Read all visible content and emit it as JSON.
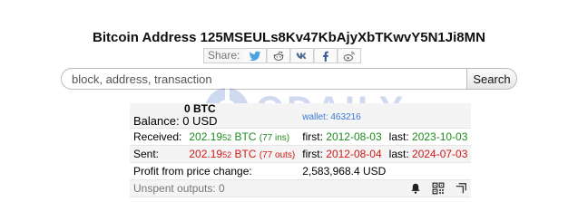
{
  "header": {
    "title": "Bitcoin Address 125MSEULs8Kv47KbAjyXbTKwvY5N1Ji8MN"
  },
  "share": {
    "label": "Share:",
    "icons": [
      "twitter-icon",
      "reddit-icon",
      "vk-icon",
      "facebook-icon",
      "weibo-icon"
    ]
  },
  "search": {
    "placeholder": "block, address, transaction",
    "button_label": "Search"
  },
  "watermark": {
    "text": "ODAILY"
  },
  "balance": {
    "btc": "0 BTC",
    "label": "Balance:",
    "usd": "0 USD",
    "wallet_link": "wallet: 463216"
  },
  "received": {
    "label": "Received:",
    "amount_main": "202.19",
    "amount_small": "52",
    "unit": "BTC",
    "count": "(77 ins)",
    "first_label": "first:",
    "first_date": "2012-08-03",
    "last_label": "last:",
    "last_date": "2023-10-03"
  },
  "sent": {
    "label": "Sent:",
    "amount_main": "202.19",
    "amount_small": "52",
    "unit": "BTC",
    "count": "(77 outs)",
    "first_label": "first:",
    "first_date": "2012-08-04",
    "last_label": "last:",
    "last_date": "2024-07-03"
  },
  "profit": {
    "label": "Profit from price change:",
    "value": "2,583,968.4 USD"
  },
  "unspent": {
    "label": "Unspent outputs: 0",
    "icons": [
      "bell-icon",
      "qr-code-icon",
      "copy-icon"
    ]
  },
  "colors": {
    "green": "#1f8a1f",
    "red": "#d01a1a",
    "link": "#3b78d8"
  }
}
